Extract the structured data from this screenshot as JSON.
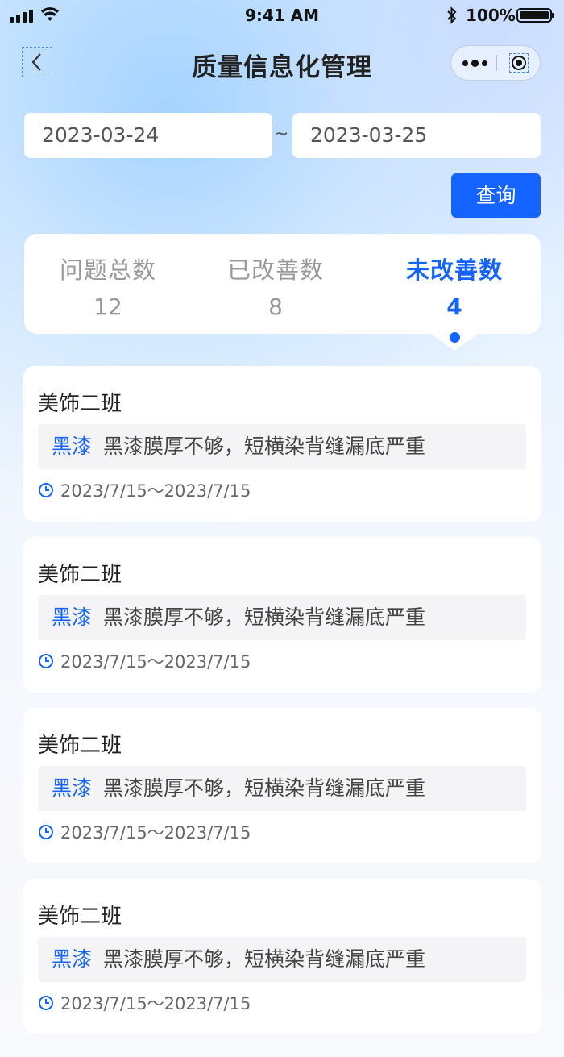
{
  "status_bar": {
    "time": "9:41 AM",
    "battery": "100%",
    "icons": [
      "signal-icon",
      "wifi-icon",
      "bluetooth-icon",
      "battery-icon"
    ]
  },
  "nav": {
    "title": "质量信息化管理",
    "back_icon": "chevron-left-icon",
    "more_icon": "more-icon",
    "close_icon": "target-close-icon"
  },
  "filter": {
    "start_date": "2023-03-24",
    "separator": "~",
    "end_date": "2023-03-25",
    "query_label": "查询"
  },
  "stats": {
    "items": [
      {
        "label": "问题总数",
        "value": "12"
      },
      {
        "label": "已改善数",
        "value": "8"
      },
      {
        "label": "未改善数",
        "value": "4"
      }
    ],
    "active_index": 2
  },
  "list": [
    {
      "team": "美饰二班",
      "tag": "黑漆",
      "description": "黑漆膜厚不够，短横染背缝漏底严重",
      "date_range": "2023/7/15～2023/7/15"
    },
    {
      "team": "美饰二班",
      "tag": "黑漆",
      "description": "黑漆膜厚不够，短横染背缝漏底严重",
      "date_range": "2023/7/15～2023/7/15"
    },
    {
      "team": "美饰二班",
      "tag": "黑漆",
      "description": "黑漆膜厚不够，短横染背缝漏底严重",
      "date_range": "2023/7/15～2023/7/15"
    },
    {
      "team": "美饰二班",
      "tag": "黑漆",
      "description": "黑漆膜厚不够，短横染背缝漏底严重",
      "date_range": "2023/7/15～2023/7/15"
    }
  ],
  "colors": {
    "accent": "#1664ff",
    "muted": "#999999",
    "card": "#ffffff"
  }
}
